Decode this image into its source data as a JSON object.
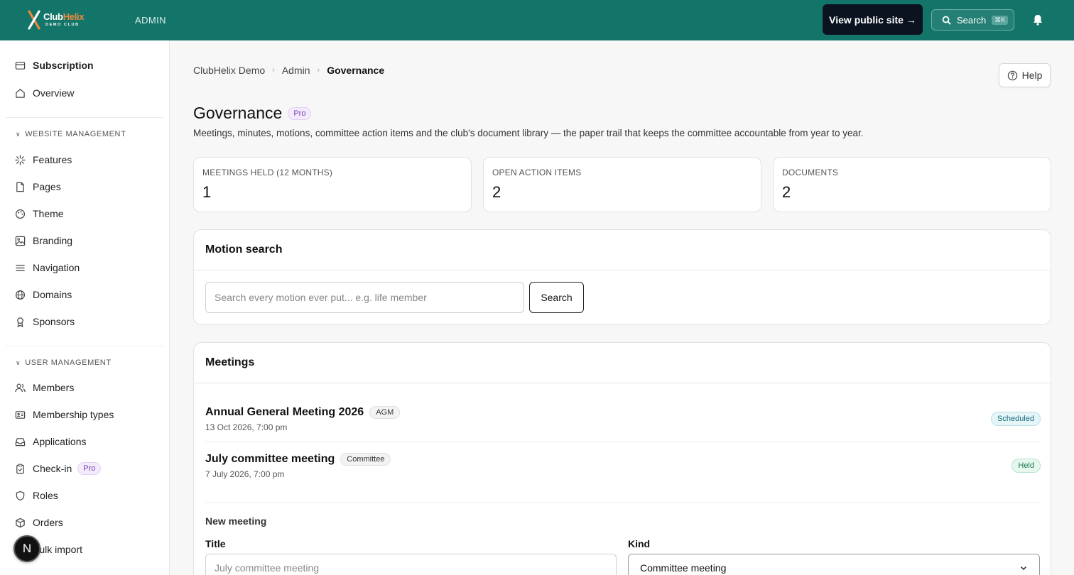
{
  "topbar": {
    "logo_club": "Club",
    "logo_helix": "Helix",
    "logo_sub": "DEMO CLUB",
    "admin_label": "ADMIN",
    "view_public_label": "View public site →",
    "search_label": "Search",
    "search_shortcut": "⌘K",
    "brand_color": "#137569"
  },
  "sidebar": {
    "top_items": [
      {
        "label": "Subscription",
        "icon": "card-icon"
      },
      {
        "label": "Overview",
        "icon": "home-icon"
      }
    ],
    "website_section": "WEBSITE MANAGEMENT",
    "website_items": [
      {
        "label": "Features",
        "icon": "sparkle-icon"
      },
      {
        "label": "Pages",
        "icon": "file-icon"
      },
      {
        "label": "Theme",
        "icon": "palette-icon"
      },
      {
        "label": "Branding",
        "icon": "image-icon"
      },
      {
        "label": "Navigation",
        "icon": "menu-icon"
      },
      {
        "label": "Domains",
        "icon": "globe-icon"
      },
      {
        "label": "Sponsors",
        "icon": "award-icon"
      }
    ],
    "user_section": "USER MANAGEMENT",
    "user_items": [
      {
        "label": "Members",
        "icon": "users-icon"
      },
      {
        "label": "Membership types",
        "icon": "id-card-icon"
      },
      {
        "label": "Applications",
        "icon": "inbox-icon"
      },
      {
        "label": "Check-in",
        "icon": "clipboard-check-icon",
        "badge": "Pro"
      },
      {
        "label": "Roles",
        "icon": "shield-icon"
      },
      {
        "label": "Orders",
        "icon": "box-icon"
      },
      {
        "label": "Bulk import",
        "icon": "upload-icon"
      }
    ],
    "avatar_letter": "N"
  },
  "breadcrumb": [
    "ClubHelix Demo",
    "Admin",
    "Governance"
  ],
  "help_label": "Help",
  "page": {
    "title": "Governance",
    "badge": "Pro",
    "description": "Meetings, minutes, motions, committee action items and the club's document library — the paper trail that keeps the committee accountable from year to year."
  },
  "stats": [
    {
      "label": "MEETINGS HELD (12 MONTHS)",
      "value": "1"
    },
    {
      "label": "OPEN ACTION ITEMS",
      "value": "2"
    },
    {
      "label": "DOCUMENTS",
      "value": "2"
    }
  ],
  "motion_search": {
    "title": "Motion search",
    "placeholder": "Search every motion ever put... e.g. life member",
    "button_label": "Search"
  },
  "meetings": {
    "title": "Meetings",
    "rows": [
      {
        "title": "Annual General Meeting 2026",
        "kind": "AGM",
        "date": "13 Oct 2026, 7:00 pm",
        "status": "Scheduled"
      },
      {
        "title": "July committee meeting",
        "kind": "Committee",
        "date": "7 July 2026, 7:00 pm",
        "status": "Held"
      }
    ],
    "new_meeting_label": "New meeting",
    "title_label": "Title",
    "title_placeholder": "July committee meeting",
    "kind_label": "Kind",
    "kind_value": "Committee meeting"
  }
}
